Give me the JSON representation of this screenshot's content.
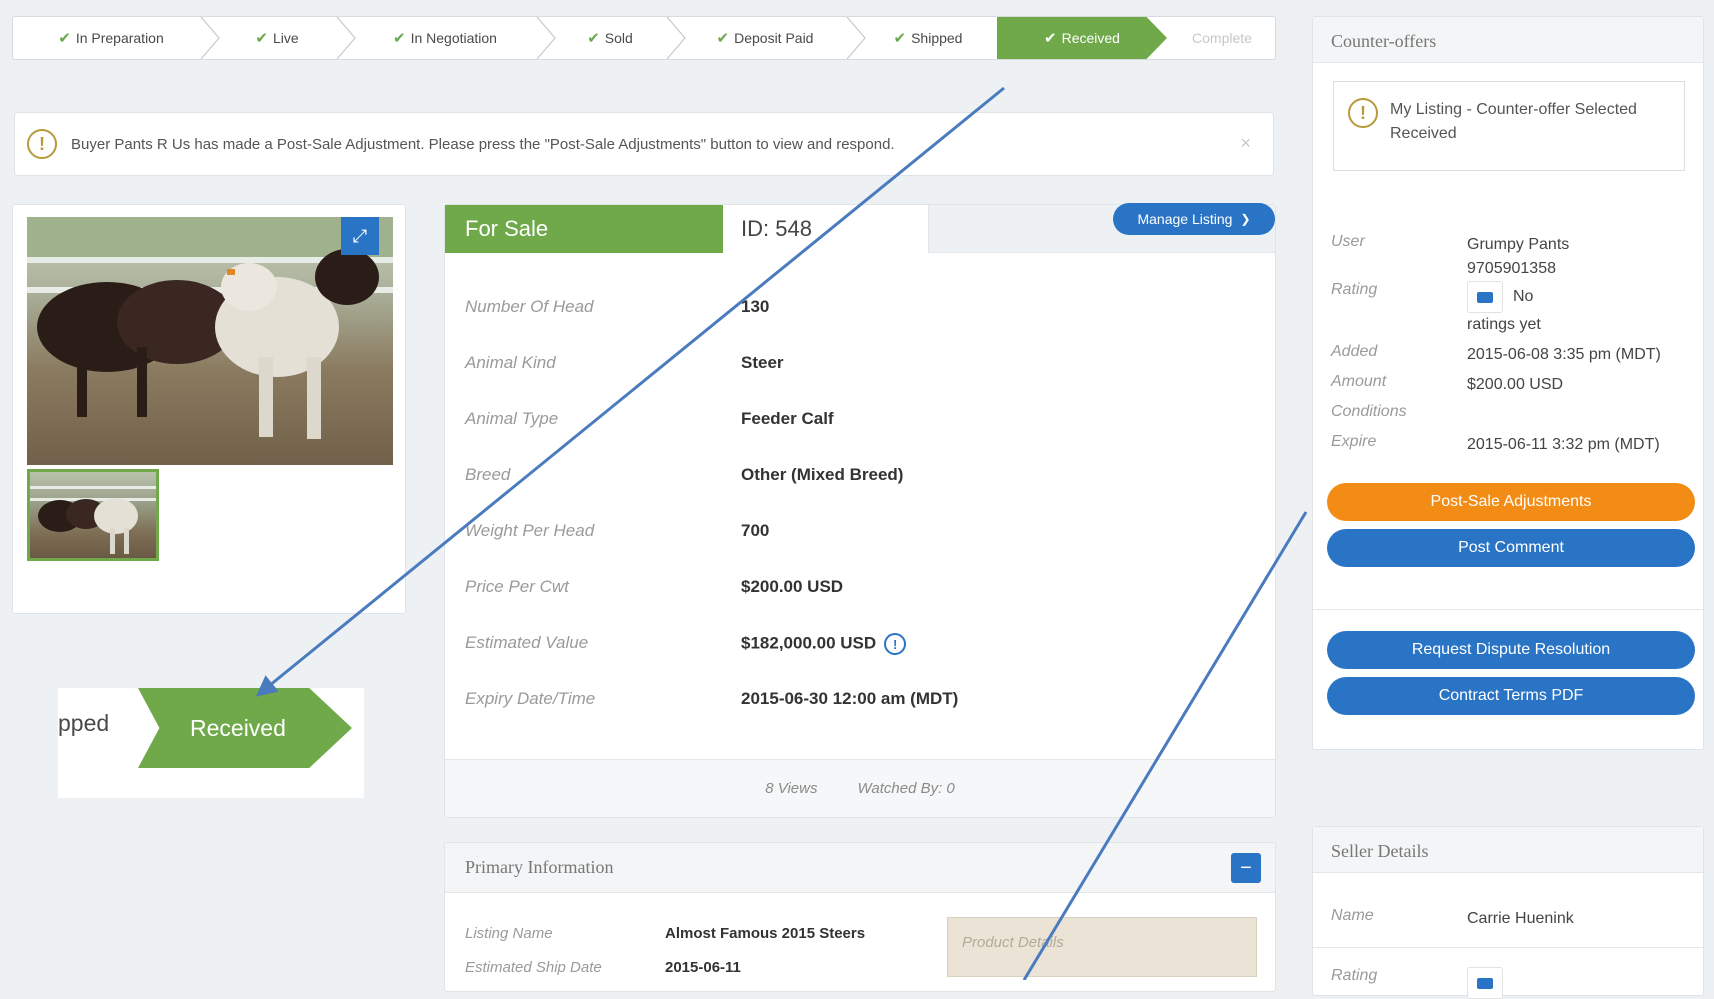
{
  "progress": {
    "steps": [
      {
        "label": "In Preparation",
        "state": "done"
      },
      {
        "label": "Live",
        "state": "done"
      },
      {
        "label": "In Negotiation",
        "state": "done"
      },
      {
        "label": "Sold",
        "state": "done"
      },
      {
        "label": "Deposit Paid",
        "state": "done"
      },
      {
        "label": "Shipped",
        "state": "done"
      },
      {
        "label": "Received",
        "state": "active"
      },
      {
        "label": "Complete",
        "state": "future"
      }
    ]
  },
  "alert": {
    "icon": "exclamation-icon",
    "message": "Buyer Pants R Us has made a Post-Sale Adjustment. Please press the \"Post-Sale Adjustments\" button to view and respond.",
    "close": "×"
  },
  "gallery": {
    "expand_icon": "expand-icon"
  },
  "zoom": {
    "prev": "pped",
    "active": "Received"
  },
  "listing": {
    "status_tab": "For Sale",
    "id_tab": "ID: 548",
    "manage_label": "Manage Listing",
    "details": [
      {
        "label": "Number Of Head",
        "value": "130"
      },
      {
        "label": "Animal Kind",
        "value": "Steer"
      },
      {
        "label": "Animal Type",
        "value": "Feeder Calf"
      },
      {
        "label": "Breed",
        "value": "Other (Mixed Breed)"
      },
      {
        "label": "Weight Per Head",
        "value": "700"
      },
      {
        "label": "Price Per Cwt",
        "value": "$200.00 USD"
      },
      {
        "label": "Estimated Value",
        "value": "$182,000.00 USD"
      },
      {
        "label": "Expiry Date/Time",
        "value": "2015-06-30 12:00 am (MDT)"
      }
    ],
    "views": "8 Views",
    "watched": "Watched By: 0"
  },
  "primary": {
    "title": "Primary Information",
    "collapse": "−",
    "rows": [
      {
        "label": "Listing Name",
        "value": "Almost Famous 2015 Steers"
      },
      {
        "label": "Estimated Ship Date",
        "value": "2015-06-11"
      }
    ],
    "product_details": "Product Details"
  },
  "counter": {
    "title": "Counter-offers",
    "note": "My Listing - Counter-offer Selected Received",
    "user_label": "User",
    "user_name": "Grumpy Pants",
    "user_phone": "9705901358",
    "rating_label": "Rating",
    "rating_value": "No",
    "rating_value2": "ratings yet",
    "added_label": "Added",
    "added_value": "2015-06-08 3:35 pm (MDT)",
    "amount_label": "Amount",
    "amount_value": "$200.00 USD",
    "conditions_label": "Conditions",
    "expire_label": "Expire",
    "expire_value": "2015-06-11 3:32 pm (MDT)",
    "post_sale_btn": "Post-Sale Adjustments",
    "post_comment_btn": "Post Comment",
    "dispute_btn": "Request Dispute Resolution",
    "contract_btn": "Contract Terms PDF"
  },
  "seller": {
    "title": "Seller Details",
    "name_label": "Name",
    "name_value": "Carrie Huenink",
    "rating_label": "Rating"
  },
  "colors": {
    "green": "#6fa94a",
    "blue": "#2a74c6",
    "orange": "#f28c14"
  }
}
